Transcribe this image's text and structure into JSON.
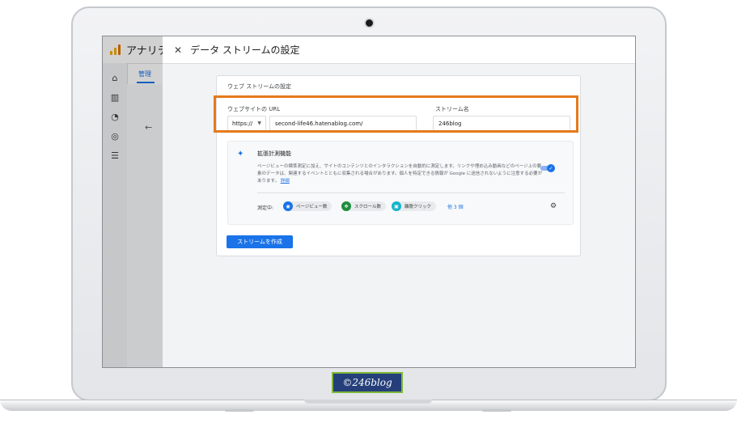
{
  "app": {
    "name": "アナリティクス"
  },
  "admin_tab": "管理",
  "panel": {
    "title": "データ ストリームの設定",
    "card_title": "ウェブ ストリームの設定",
    "url_label": "ウェブサイトの URL",
    "protocol": "https://",
    "url_value": "second-life46.hatenablog.com/",
    "stream_name_label": "ストリーム名",
    "stream_name_value": "246blog",
    "enhanced": {
      "title": "拡張計測機能",
      "description": "ページビューの標準測定に加え、サイトのコンテンツとのインタラクションを自動的に測定します。リンクや埋め込み動画などのページ上の要素のデータは、関連するイベントとともに収集される場合があります。個人を特定できる情報が Google に送信されないように注意する必要があります。",
      "details_link": "詳細",
      "toggle_on": true,
      "measuring_label": "測定中:",
      "chips": [
        {
          "label": "ページビュー数",
          "icon": "eye-icon",
          "color": "#1a73e8"
        },
        {
          "label": "スクロール数",
          "icon": "scroll-arrows-icon",
          "color": "#1e8e3e"
        },
        {
          "label": "離脱クリック",
          "icon": "lock-icon",
          "color": "#12b5cb"
        }
      ],
      "more_link": "他 3 個"
    },
    "create_button": "ストリームを作成"
  },
  "watermark": "©246blog",
  "colors": {
    "accent": "#1a73e8",
    "highlight": "#e57a1c",
    "watermark_bg": "#243f7a"
  }
}
